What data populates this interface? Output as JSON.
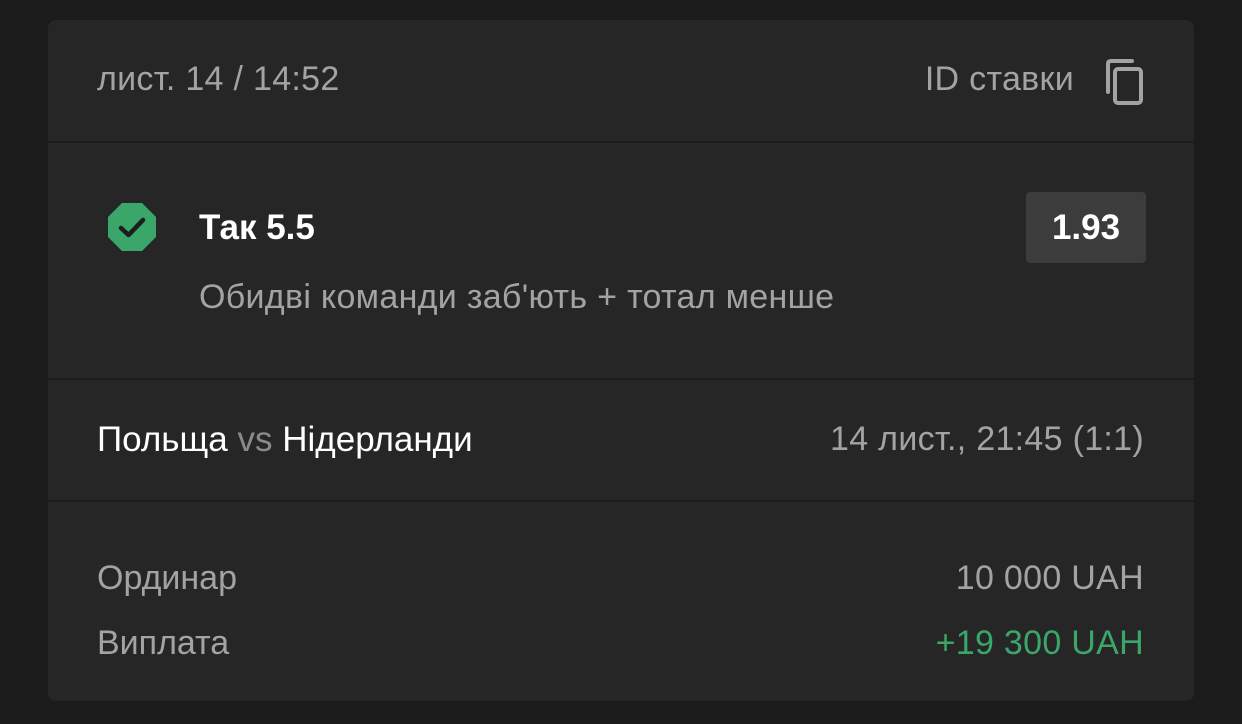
{
  "header": {
    "date": "лист. 14 / 14:52",
    "bet_id_label": "ID ставки",
    "copy_icon": "copy-icon"
  },
  "selection": {
    "status_icon": "check-octagon-icon",
    "status_color": "#3aa66a",
    "title": "Так 5.5",
    "odds": "1.93",
    "description": "Обидві команди заб'ють + тотал менше"
  },
  "match": {
    "team_home": "Польща",
    "vs": "vs",
    "team_away": "Нідерланди",
    "time": "14 лист., 21:45 (1:1)"
  },
  "summary": {
    "type_label": "Ординар",
    "stake": "10 000 UAH",
    "payout_label": "Виплата",
    "payout": "+19 300 UAH",
    "payout_color": "#3aa66a"
  }
}
